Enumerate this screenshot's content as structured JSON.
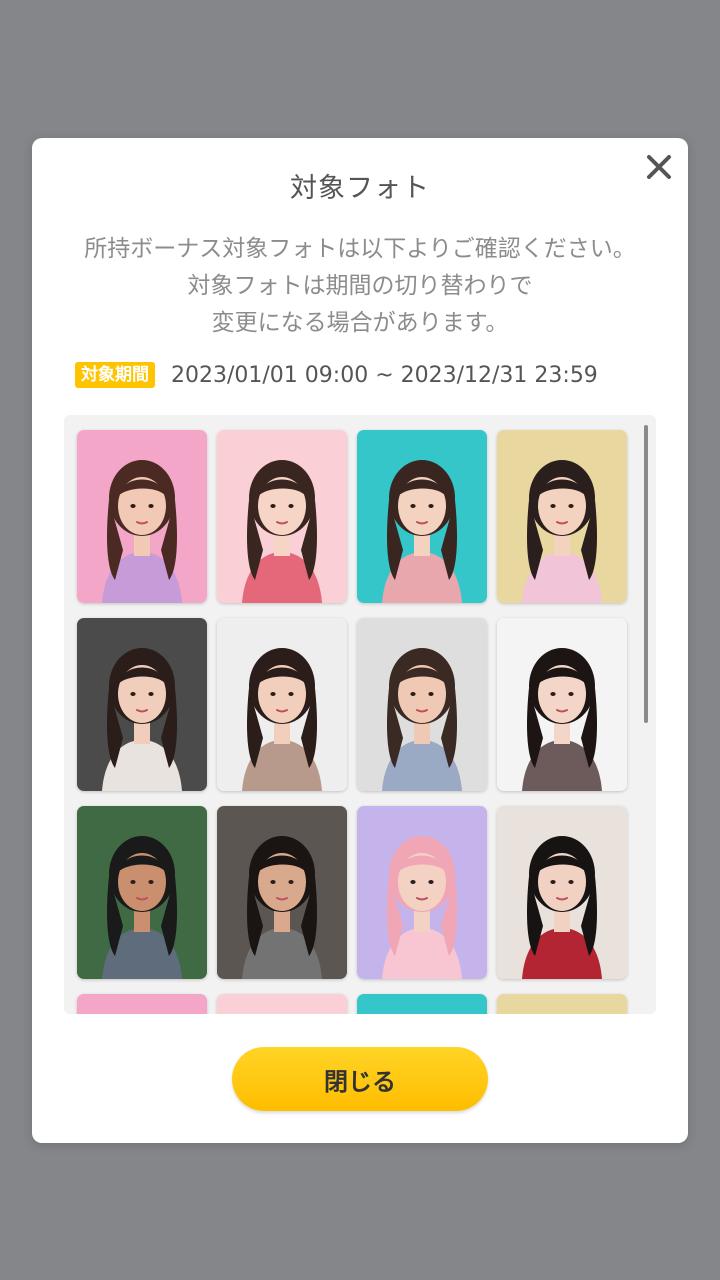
{
  "dialog": {
    "title": "対象フォト",
    "description_lines": [
      "所持ボーナス対象フォトは以下よりご確認ください。",
      "対象フォトは期間の切り替わりで",
      "変更になる場合があります。"
    ],
    "period_badge": "対象期間",
    "period_range": "2023/01/01 09:00 ~ 2023/12/31 23:59",
    "close_button_label": "閉じる",
    "close_icon": "close-icon"
  },
  "photos": [
    {
      "name": "photo-1",
      "bg": "#f3a6c8",
      "skin": "#f1c9b4",
      "hair": "#4a2a22",
      "top": "#c79ad8"
    },
    {
      "name": "photo-2",
      "bg": "#fbcfd6",
      "skin": "#f6d5c6",
      "hair": "#3a2620",
      "top": "#e4677a"
    },
    {
      "name": "photo-3",
      "bg": "#35c6c9",
      "skin": "#f3d2c0",
      "hair": "#3a2620",
      "top": "#e8a6ad"
    },
    {
      "name": "photo-4",
      "bg": "#e9d7a0",
      "skin": "#f3d2c0",
      "hair": "#2a1f1c",
      "top": "#f1c4d8"
    },
    {
      "name": "photo-5",
      "bg": "#4b4b4b",
      "skin": "#f1cdbb",
      "hair": "#2a1d1a",
      "top": "#e9e3e0"
    },
    {
      "name": "photo-6",
      "bg": "#eeeeee",
      "skin": "#f2cfbd",
      "hair": "#2a1d1a",
      "top": "#b79a8c"
    },
    {
      "name": "photo-7",
      "bg": "#dedede",
      "skin": "#f0c9b4",
      "hair": "#3b2a24",
      "top": "#9aa9c4"
    },
    {
      "name": "photo-8",
      "bg": "#f4f4f4",
      "skin": "#f3d6c7",
      "hair": "#1c1514",
      "top": "#6d5b5b"
    },
    {
      "name": "photo-9",
      "bg": "#3f6a44",
      "skin": "#c98f6e",
      "hair": "#1a1a1a",
      "top": "#5f6c7c"
    },
    {
      "name": "photo-10",
      "bg": "#5b5652",
      "skin": "#d9a98e",
      "hair": "#1a1412",
      "top": "#737373"
    },
    {
      "name": "photo-11",
      "bg": "#c5b4ec",
      "skin": "#f3d2c4",
      "hair": "#f0a6b4",
      "top": "#f8c6d3"
    },
    {
      "name": "photo-12",
      "bg": "#e9e2dc",
      "skin": "#f1d1c2",
      "hair": "#171312",
      "top": "#b32532"
    },
    {
      "name": "photo-13",
      "bg": "#f3a6c8",
      "skin": "#f1c9b4",
      "hair": "#4a2a22",
      "top": "#c79ad8"
    },
    {
      "name": "photo-14",
      "bg": "#fbcfd6",
      "skin": "#f6d5c6",
      "hair": "#3a2620",
      "top": "#e4677a"
    },
    {
      "name": "photo-15",
      "bg": "#35c6c9",
      "skin": "#f3d2c0",
      "hair": "#3a2620",
      "top": "#e8a6ad"
    },
    {
      "name": "photo-16",
      "bg": "#e9d7a0",
      "skin": "#f3d2c0",
      "hair": "#2a1f1c",
      "top": "#f1c4d8"
    }
  ],
  "colors": {
    "accent": "#ffc400",
    "overlay": "#85868a"
  }
}
